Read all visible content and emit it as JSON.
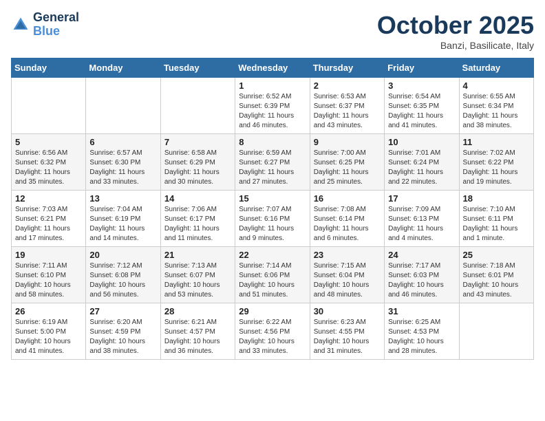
{
  "header": {
    "logo_line1": "General",
    "logo_line2": "Blue",
    "month": "October 2025",
    "location": "Banzi, Basilicate, Italy"
  },
  "weekdays": [
    "Sunday",
    "Monday",
    "Tuesday",
    "Wednesday",
    "Thursday",
    "Friday",
    "Saturday"
  ],
  "weeks": [
    [
      {
        "day": "",
        "info": ""
      },
      {
        "day": "",
        "info": ""
      },
      {
        "day": "",
        "info": ""
      },
      {
        "day": "1",
        "info": "Sunrise: 6:52 AM\nSunset: 6:39 PM\nDaylight: 11 hours\nand 46 minutes."
      },
      {
        "day": "2",
        "info": "Sunrise: 6:53 AM\nSunset: 6:37 PM\nDaylight: 11 hours\nand 43 minutes."
      },
      {
        "day": "3",
        "info": "Sunrise: 6:54 AM\nSunset: 6:35 PM\nDaylight: 11 hours\nand 41 minutes."
      },
      {
        "day": "4",
        "info": "Sunrise: 6:55 AM\nSunset: 6:34 PM\nDaylight: 11 hours\nand 38 minutes."
      }
    ],
    [
      {
        "day": "5",
        "info": "Sunrise: 6:56 AM\nSunset: 6:32 PM\nDaylight: 11 hours\nand 35 minutes."
      },
      {
        "day": "6",
        "info": "Sunrise: 6:57 AM\nSunset: 6:30 PM\nDaylight: 11 hours\nand 33 minutes."
      },
      {
        "day": "7",
        "info": "Sunrise: 6:58 AM\nSunset: 6:29 PM\nDaylight: 11 hours\nand 30 minutes."
      },
      {
        "day": "8",
        "info": "Sunrise: 6:59 AM\nSunset: 6:27 PM\nDaylight: 11 hours\nand 27 minutes."
      },
      {
        "day": "9",
        "info": "Sunrise: 7:00 AM\nSunset: 6:25 PM\nDaylight: 11 hours\nand 25 minutes."
      },
      {
        "day": "10",
        "info": "Sunrise: 7:01 AM\nSunset: 6:24 PM\nDaylight: 11 hours\nand 22 minutes."
      },
      {
        "day": "11",
        "info": "Sunrise: 7:02 AM\nSunset: 6:22 PM\nDaylight: 11 hours\nand 19 minutes."
      }
    ],
    [
      {
        "day": "12",
        "info": "Sunrise: 7:03 AM\nSunset: 6:21 PM\nDaylight: 11 hours\nand 17 minutes."
      },
      {
        "day": "13",
        "info": "Sunrise: 7:04 AM\nSunset: 6:19 PM\nDaylight: 11 hours\nand 14 minutes."
      },
      {
        "day": "14",
        "info": "Sunrise: 7:06 AM\nSunset: 6:17 PM\nDaylight: 11 hours\nand 11 minutes."
      },
      {
        "day": "15",
        "info": "Sunrise: 7:07 AM\nSunset: 6:16 PM\nDaylight: 11 hours\nand 9 minutes."
      },
      {
        "day": "16",
        "info": "Sunrise: 7:08 AM\nSunset: 6:14 PM\nDaylight: 11 hours\nand 6 minutes."
      },
      {
        "day": "17",
        "info": "Sunrise: 7:09 AM\nSunset: 6:13 PM\nDaylight: 11 hours\nand 4 minutes."
      },
      {
        "day": "18",
        "info": "Sunrise: 7:10 AM\nSunset: 6:11 PM\nDaylight: 11 hours\nand 1 minute."
      }
    ],
    [
      {
        "day": "19",
        "info": "Sunrise: 7:11 AM\nSunset: 6:10 PM\nDaylight: 10 hours\nand 58 minutes."
      },
      {
        "day": "20",
        "info": "Sunrise: 7:12 AM\nSunset: 6:08 PM\nDaylight: 10 hours\nand 56 minutes."
      },
      {
        "day": "21",
        "info": "Sunrise: 7:13 AM\nSunset: 6:07 PM\nDaylight: 10 hours\nand 53 minutes."
      },
      {
        "day": "22",
        "info": "Sunrise: 7:14 AM\nSunset: 6:06 PM\nDaylight: 10 hours\nand 51 minutes."
      },
      {
        "day": "23",
        "info": "Sunrise: 7:15 AM\nSunset: 6:04 PM\nDaylight: 10 hours\nand 48 minutes."
      },
      {
        "day": "24",
        "info": "Sunrise: 7:17 AM\nSunset: 6:03 PM\nDaylight: 10 hours\nand 46 minutes."
      },
      {
        "day": "25",
        "info": "Sunrise: 7:18 AM\nSunset: 6:01 PM\nDaylight: 10 hours\nand 43 minutes."
      }
    ],
    [
      {
        "day": "26",
        "info": "Sunrise: 6:19 AM\nSunset: 5:00 PM\nDaylight: 10 hours\nand 41 minutes."
      },
      {
        "day": "27",
        "info": "Sunrise: 6:20 AM\nSunset: 4:59 PM\nDaylight: 10 hours\nand 38 minutes."
      },
      {
        "day": "28",
        "info": "Sunrise: 6:21 AM\nSunset: 4:57 PM\nDaylight: 10 hours\nand 36 minutes."
      },
      {
        "day": "29",
        "info": "Sunrise: 6:22 AM\nSunset: 4:56 PM\nDaylight: 10 hours\nand 33 minutes."
      },
      {
        "day": "30",
        "info": "Sunrise: 6:23 AM\nSunset: 4:55 PM\nDaylight: 10 hours\nand 31 minutes."
      },
      {
        "day": "31",
        "info": "Sunrise: 6:25 AM\nSunset: 4:53 PM\nDaylight: 10 hours\nand 28 minutes."
      },
      {
        "day": "",
        "info": ""
      }
    ]
  ]
}
